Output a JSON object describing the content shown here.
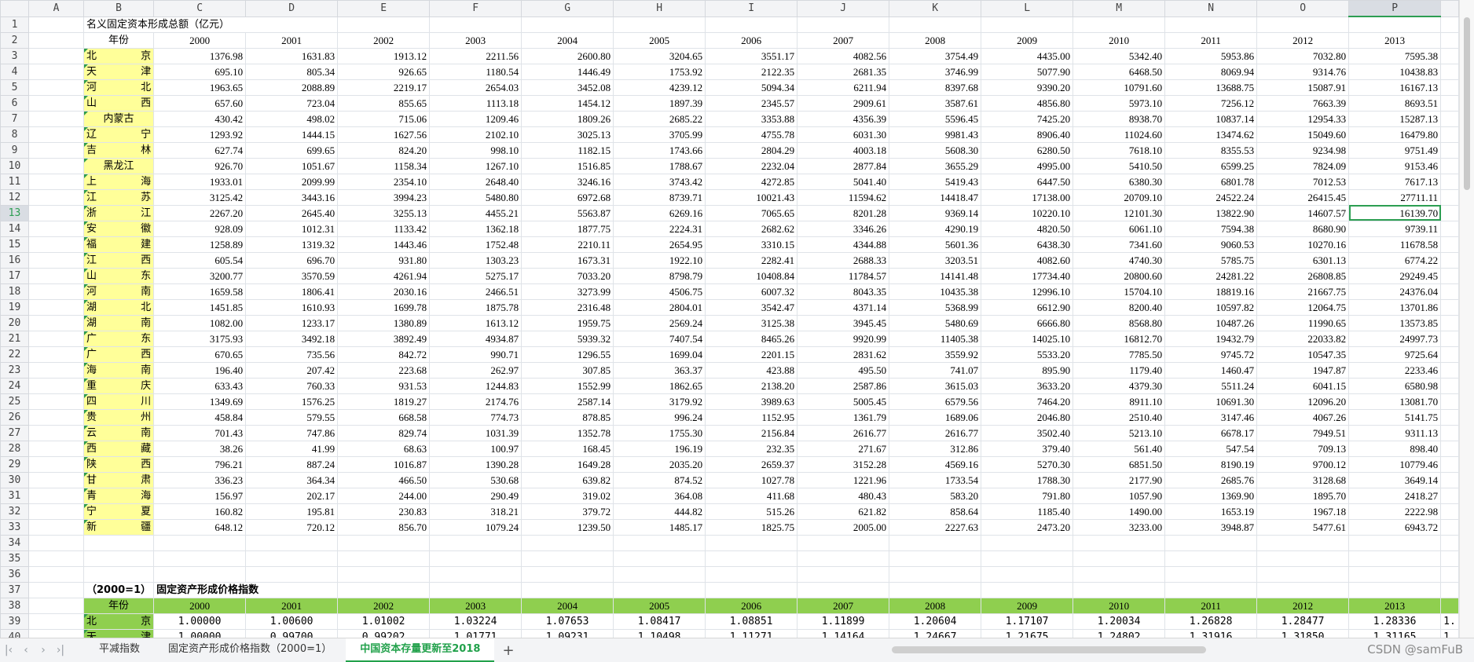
{
  "columns": [
    "A",
    "B",
    "C",
    "D",
    "E",
    "F",
    "G",
    "H",
    "I",
    "J",
    "K",
    "L",
    "M",
    "N",
    "O",
    "P"
  ],
  "selected_column": "P",
  "selected_row": 13,
  "title1": "名义固定资本形成总额（亿元）",
  "year_label": "年份",
  "years": [
    "2000",
    "2001",
    "2002",
    "2003",
    "2004",
    "2005",
    "2006",
    "2007",
    "2008",
    "2009",
    "2010",
    "2011",
    "2012",
    "2013"
  ],
  "provinces": [
    {
      "name": [
        "北",
        "京"
      ],
      "values": [
        "1376.98",
        "1631.83",
        "1913.12",
        "2211.56",
        "2600.80",
        "3204.65",
        "3551.17",
        "4082.56",
        "3754.49",
        "4435.00",
        "5342.40",
        "5953.86",
        "7032.80",
        "7595.38"
      ]
    },
    {
      "name": [
        "天",
        "津"
      ],
      "values": [
        "695.10",
        "805.34",
        "926.65",
        "1180.54",
        "1446.49",
        "1753.92",
        "2122.35",
        "2681.35",
        "3746.99",
        "5077.90",
        "6468.50",
        "8069.94",
        "9314.76",
        "10438.83"
      ]
    },
    {
      "name": [
        "河",
        "北"
      ],
      "values": [
        "1963.65",
        "2088.89",
        "2219.17",
        "2654.03",
        "3452.08",
        "4239.12",
        "5094.34",
        "6211.94",
        "8397.68",
        "9390.20",
        "10791.60",
        "13688.75",
        "15087.91",
        "16167.13"
      ]
    },
    {
      "name": [
        "山",
        "西"
      ],
      "values": [
        "657.60",
        "723.04",
        "855.65",
        "1113.18",
        "1454.12",
        "1897.39",
        "2345.57",
        "2909.61",
        "3587.61",
        "4856.80",
        "5973.10",
        "7256.12",
        "7663.39",
        "8693.51"
      ]
    },
    {
      "name": [
        "内蒙古"
      ],
      "values": [
        "430.42",
        "498.02",
        "715.06",
        "1209.46",
        "1809.26",
        "2685.22",
        "3353.88",
        "4356.39",
        "5596.45",
        "7425.20",
        "8938.70",
        "10837.14",
        "12954.33",
        "15287.13"
      ]
    },
    {
      "name": [
        "辽",
        "宁"
      ],
      "values": [
        "1293.92",
        "1444.15",
        "1627.56",
        "2102.10",
        "3025.13",
        "3705.99",
        "4755.78",
        "6031.30",
        "9981.43",
        "8906.40",
        "11024.60",
        "13474.62",
        "15049.60",
        "16479.80"
      ]
    },
    {
      "name": [
        "吉",
        "林"
      ],
      "values": [
        "627.74",
        "699.65",
        "824.20",
        "998.10",
        "1182.15",
        "1743.66",
        "2804.29",
        "4003.18",
        "5608.30",
        "6280.50",
        "7618.10",
        "8355.53",
        "9234.98",
        "9751.49"
      ]
    },
    {
      "name": [
        "黑龙江"
      ],
      "values": [
        "926.70",
        "1051.67",
        "1158.34",
        "1267.10",
        "1516.85",
        "1788.67",
        "2232.04",
        "2877.84",
        "3655.29",
        "4995.00",
        "5410.50",
        "6599.25",
        "7824.09",
        "9153.46"
      ]
    },
    {
      "name": [
        "上",
        "海"
      ],
      "values": [
        "1933.01",
        "2099.99",
        "2354.10",
        "2648.40",
        "3246.16",
        "3743.42",
        "4272.85",
        "5041.40",
        "5419.43",
        "6447.50",
        "6380.30",
        "6801.78",
        "7012.53",
        "7617.13"
      ]
    },
    {
      "name": [
        "江",
        "苏"
      ],
      "values": [
        "3125.42",
        "3443.16",
        "3994.23",
        "5480.80",
        "6972.68",
        "8739.71",
        "10021.43",
        "11594.62",
        "14418.47",
        "17138.00",
        "20709.10",
        "24522.24",
        "26415.45",
        "27711.11"
      ]
    },
    {
      "name": [
        "浙",
        "江"
      ],
      "values": [
        "2267.20",
        "2645.40",
        "3255.13",
        "4455.21",
        "5563.87",
        "6269.16",
        "7065.65",
        "8201.28",
        "9369.14",
        "10220.10",
        "12101.30",
        "13822.90",
        "14607.57",
        "16139.70"
      ]
    },
    {
      "name": [
        "安",
        "徽"
      ],
      "values": [
        "928.09",
        "1012.31",
        "1133.42",
        "1362.18",
        "1877.75",
        "2224.31",
        "2682.62",
        "3346.26",
        "4290.19",
        "4820.50",
        "6061.10",
        "7594.38",
        "8680.90",
        "9739.11"
      ]
    },
    {
      "name": [
        "福",
        "建"
      ],
      "values": [
        "1258.89",
        "1319.32",
        "1443.46",
        "1752.48",
        "2210.11",
        "2654.95",
        "3310.15",
        "4344.88",
        "5601.36",
        "6438.30",
        "7341.60",
        "9060.53",
        "10270.16",
        "11678.58"
      ]
    },
    {
      "name": [
        "江",
        "西"
      ],
      "values": [
        "605.54",
        "696.70",
        "931.80",
        "1303.23",
        "1673.31",
        "1922.10",
        "2282.41",
        "2688.33",
        "3203.51",
        "4082.60",
        "4740.30",
        "5785.75",
        "6301.13",
        "6774.22"
      ]
    },
    {
      "name": [
        "山",
        "东"
      ],
      "values": [
        "3200.77",
        "3570.59",
        "4261.94",
        "5275.17",
        "7033.20",
        "8798.79",
        "10408.84",
        "11784.57",
        "14141.48",
        "17734.40",
        "20800.60",
        "24281.22",
        "26808.85",
        "29249.45"
      ]
    },
    {
      "name": [
        "河",
        "南"
      ],
      "values": [
        "1659.58",
        "1806.41",
        "2030.16",
        "2466.51",
        "3273.99",
        "4506.75",
        "6007.32",
        "8043.35",
        "10435.38",
        "12996.10",
        "15704.10",
        "18819.16",
        "21667.75",
        "24376.04"
      ]
    },
    {
      "name": [
        "湖",
        "北"
      ],
      "values": [
        "1451.85",
        "1610.93",
        "1699.78",
        "1875.78",
        "2316.48",
        "2804.01",
        "3542.47",
        "4371.14",
        "5368.99",
        "6612.90",
        "8200.40",
        "10597.82",
        "12064.75",
        "13701.86"
      ]
    },
    {
      "name": [
        "湖",
        "南"
      ],
      "values": [
        "1082.00",
        "1233.17",
        "1380.89",
        "1613.12",
        "1959.75",
        "2569.24",
        "3125.38",
        "3945.45",
        "5480.69",
        "6666.80",
        "8568.80",
        "10487.26",
        "11990.65",
        "13573.85"
      ]
    },
    {
      "name": [
        "广",
        "东"
      ],
      "values": [
        "3175.93",
        "3492.18",
        "3892.49",
        "4934.87",
        "5939.32",
        "7407.54",
        "8465.26",
        "9920.99",
        "11405.38",
        "14025.10",
        "16812.70",
        "19432.79",
        "22033.82",
        "24997.73"
      ]
    },
    {
      "name": [
        "广",
        "西"
      ],
      "values": [
        "670.65",
        "735.56",
        "842.72",
        "990.71",
        "1296.55",
        "1699.04",
        "2201.15",
        "2831.62",
        "3559.92",
        "5533.20",
        "7785.50",
        "9745.72",
        "10547.35",
        "9725.64"
      ]
    },
    {
      "name": [
        "海",
        "南"
      ],
      "values": [
        "196.40",
        "207.42",
        "223.68",
        "262.97",
        "307.85",
        "363.37",
        "423.88",
        "495.50",
        "741.07",
        "895.90",
        "1179.40",
        "1460.47",
        "1947.87",
        "2233.46"
      ]
    },
    {
      "name": [
        "重",
        "庆"
      ],
      "values": [
        "633.43",
        "760.33",
        "931.53",
        "1244.83",
        "1552.99",
        "1862.65",
        "2138.20",
        "2587.86",
        "3615.03",
        "3633.20",
        "4379.30",
        "5511.24",
        "6041.15",
        "6580.98"
      ]
    },
    {
      "name": [
        "四",
        "川"
      ],
      "values": [
        "1349.69",
        "1576.25",
        "1819.27",
        "2174.76",
        "2587.14",
        "3179.92",
        "3989.63",
        "5005.45",
        "6579.56",
        "7464.20",
        "8911.10",
        "10691.30",
        "12096.20",
        "13081.70"
      ]
    },
    {
      "name": [
        "贵",
        "州"
      ],
      "values": [
        "458.84",
        "579.55",
        "668.58",
        "774.73",
        "878.85",
        "996.24",
        "1152.95",
        "1361.79",
        "1689.06",
        "2046.80",
        "2510.40",
        "3147.46",
        "4067.26",
        "5141.75"
      ]
    },
    {
      "name": [
        "云",
        "南"
      ],
      "values": [
        "701.43",
        "747.86",
        "829.74",
        "1031.39",
        "1352.78",
        "1755.30",
        "2156.84",
        "2616.77",
        "2616.77",
        "3502.40",
        "5213.10",
        "6678.17",
        "7949.51",
        "9311.13"
      ]
    },
    {
      "name": [
        "西",
        "藏"
      ],
      "values": [
        "38.26",
        "41.99",
        "68.63",
        "100.97",
        "168.45",
        "196.19",
        "232.35",
        "271.67",
        "312.86",
        "379.40",
        "561.40",
        "547.54",
        "709.13",
        "898.40"
      ]
    },
    {
      "name": [
        "陕",
        "西"
      ],
      "values": [
        "796.21",
        "887.24",
        "1016.87",
        "1390.28",
        "1649.28",
        "2035.20",
        "2659.37",
        "3152.28",
        "4569.16",
        "5270.30",
        "6851.50",
        "8190.19",
        "9700.12",
        "10779.46"
      ]
    },
    {
      "name": [
        "甘",
        "肃"
      ],
      "values": [
        "336.23",
        "364.34",
        "466.50",
        "530.68",
        "639.82",
        "874.52",
        "1027.78",
        "1221.96",
        "1733.54",
        "1788.30",
        "2177.90",
        "2685.76",
        "3128.68",
        "3649.14"
      ]
    },
    {
      "name": [
        "青",
        "海"
      ],
      "values": [
        "156.97",
        "202.17",
        "244.00",
        "290.49",
        "319.02",
        "364.08",
        "411.68",
        "480.43",
        "583.20",
        "791.80",
        "1057.90",
        "1369.90",
        "1895.70",
        "2418.27"
      ]
    },
    {
      "name": [
        "宁",
        "夏"
      ],
      "values": [
        "160.82",
        "195.81",
        "230.83",
        "318.21",
        "379.72",
        "444.82",
        "515.26",
        "621.82",
        "858.64",
        "1185.40",
        "1490.00",
        "1653.19",
        "1967.18",
        "2222.98"
      ]
    },
    {
      "name": [
        "新",
        "疆"
      ],
      "values": [
        "648.12",
        "720.12",
        "856.70",
        "1079.24",
        "1239.50",
        "1485.17",
        "1825.75",
        "2005.00",
        "2227.63",
        "2473.20",
        "3233.00",
        "3948.87",
        "5477.61",
        "6943.72"
      ]
    }
  ],
  "section2": {
    "base_label": "（2000=1）",
    "title": "固定资产形成价格指数",
    "year_label": "年份",
    "rows": [
      {
        "name": [
          "北",
          "京"
        ],
        "values": [
          "1.00000",
          "1.00600",
          "1.01002",
          "1.03224",
          "1.07653",
          "1.08417",
          "1.08851",
          "1.11899",
          "1.20604",
          "1.17107",
          "1.20034",
          "1.26828",
          "1.28477",
          "1.28336"
        ],
        "overflow": "1."
      },
      {
        "name": [
          "天",
          "津"
        ],
        "values": [
          "1.00000",
          "0.99700",
          "0.99202",
          "1.01771",
          "1.09231",
          "1.10498",
          "1.11271",
          "1.14164",
          "1.24667",
          "1.21675",
          "1.24802",
          "1.31916",
          "1.31850",
          "1.31165"
        ],
        "overflow": "1."
      }
    ]
  },
  "tabs": [
    {
      "label": "平减指数",
      "active": false
    },
    {
      "label": "固定资产形成价格指数（2000=1）",
      "active": false
    },
    {
      "label": "中国资本存量更新至2018",
      "active": true
    }
  ],
  "nav_icons": [
    "first-sheet-icon",
    "prev-sheet-icon",
    "next-sheet-icon",
    "last-sheet-icon"
  ],
  "add_tab_label": "+",
  "watermark": "CSDN @samFuB",
  "colors": {
    "accent": "#22a14b",
    "province_bg": "#ffff99",
    "header_bar": "#8fcf4f"
  }
}
